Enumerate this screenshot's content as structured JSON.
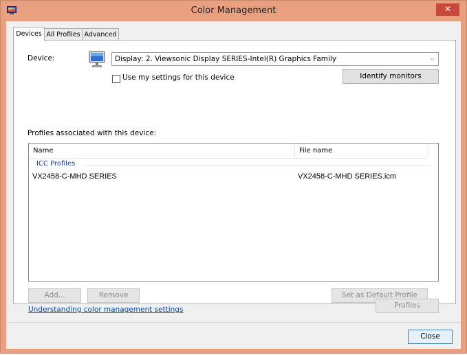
{
  "window": {
    "title": "Color Management",
    "close_glyph": "✕"
  },
  "tabs": [
    {
      "label": "Devices",
      "active": true
    },
    {
      "label": "All Profiles",
      "active": false
    },
    {
      "label": "Advanced",
      "active": false
    }
  ],
  "device": {
    "label": "Device:",
    "selected": "Display: 2. Viewsonic Display SERIES-Intel(R) Graphics Family",
    "use_my_settings_label": "Use my settings for this device",
    "use_my_settings_checked": false,
    "identify_button": "Identify monitors"
  },
  "profiles": {
    "section_label": "Profiles associated with this device:",
    "columns": [
      "Name",
      "File name"
    ],
    "group": "ICC Profiles",
    "rows": [
      {
        "name": "VX2458-C-MHD SERIES",
        "file": "VX2458-C-MHD SERIES.icm"
      }
    ]
  },
  "buttons": {
    "add": "Add...",
    "remove": "Remove",
    "set_default": "Set as Default Profile",
    "profiles": "Profiles",
    "close": "Close"
  },
  "link": "Understanding color management settings",
  "colors": {
    "title_bar": "#e8a080",
    "close_button": "#c8493a",
    "link": "#0d47a1"
  },
  "icons": {
    "app": "color-management-icon",
    "device": "monitor-icon",
    "dropdown": "chevron-down-icon"
  }
}
